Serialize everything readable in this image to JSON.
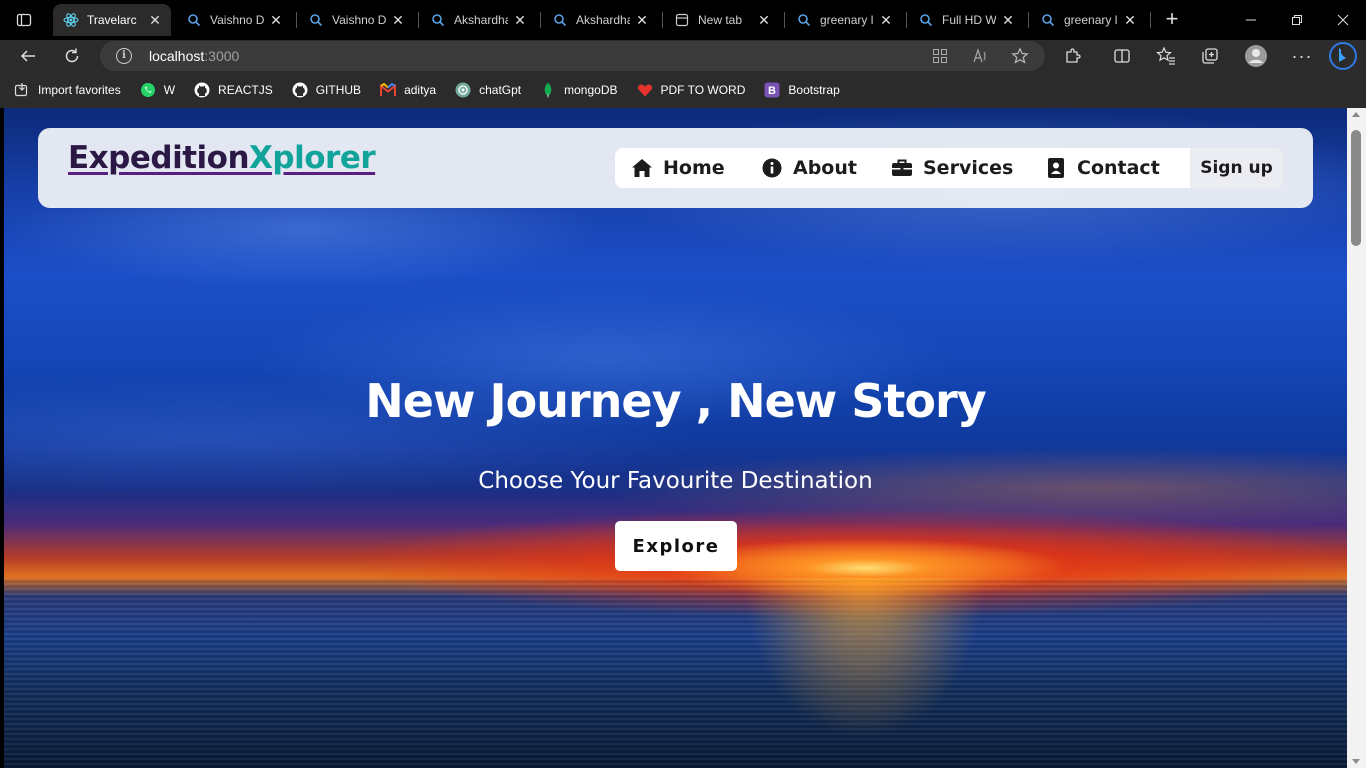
{
  "browser": {
    "tabs": [
      {
        "title": "Travelarc",
        "favicon": "react-icon",
        "active": true
      },
      {
        "title": "Vaishno De",
        "favicon": "search-icon",
        "active": false
      },
      {
        "title": "Vaishno De",
        "favicon": "search-icon",
        "active": false
      },
      {
        "title": "Akshardha",
        "favicon": "search-icon",
        "active": false
      },
      {
        "title": "Akshardha",
        "favicon": "search-icon",
        "active": false
      },
      {
        "title": "New tab",
        "favicon": "newtab-icon",
        "active": false
      },
      {
        "title": "greenary la",
        "favicon": "search-icon",
        "active": false
      },
      {
        "title": "Full HD Wa",
        "favicon": "search-icon",
        "active": false
      },
      {
        "title": "greenary la",
        "favicon": "search-icon",
        "active": false
      }
    ],
    "address": {
      "host": "localhost",
      "port": ":3000"
    },
    "favorites": [
      {
        "label": "Import favorites",
        "icon": "import-icon"
      },
      {
        "label": "W",
        "icon": "whatsapp-icon"
      },
      {
        "label": "REACTJS",
        "icon": "github-icon"
      },
      {
        "label": "GITHUB",
        "icon": "github-icon"
      },
      {
        "label": "aditya",
        "icon": "gmail-icon"
      },
      {
        "label": "chatGpt",
        "icon": "chatgpt-icon"
      },
      {
        "label": "mongoDB",
        "icon": "mongodb-icon"
      },
      {
        "label": "PDF TO WORD",
        "icon": "pdf-icon"
      },
      {
        "label": "Bootstrap",
        "icon": "bootstrap-icon"
      }
    ]
  },
  "site": {
    "brand_part1": "Expedition",
    "brand_part2": "Xplorer",
    "nav": {
      "home": "Home",
      "about": "About",
      "services": "Services",
      "contact": "Contact",
      "signup": "Sign up"
    },
    "hero": {
      "title": "New Journey , New Story",
      "subtitle": "Choose Your Favourite Destination",
      "cta": "Explore"
    }
  },
  "colors": {
    "brand_dark": "#2b1845",
    "brand_accent": "#12a49b",
    "brand_underline": "#5a1f7d"
  }
}
